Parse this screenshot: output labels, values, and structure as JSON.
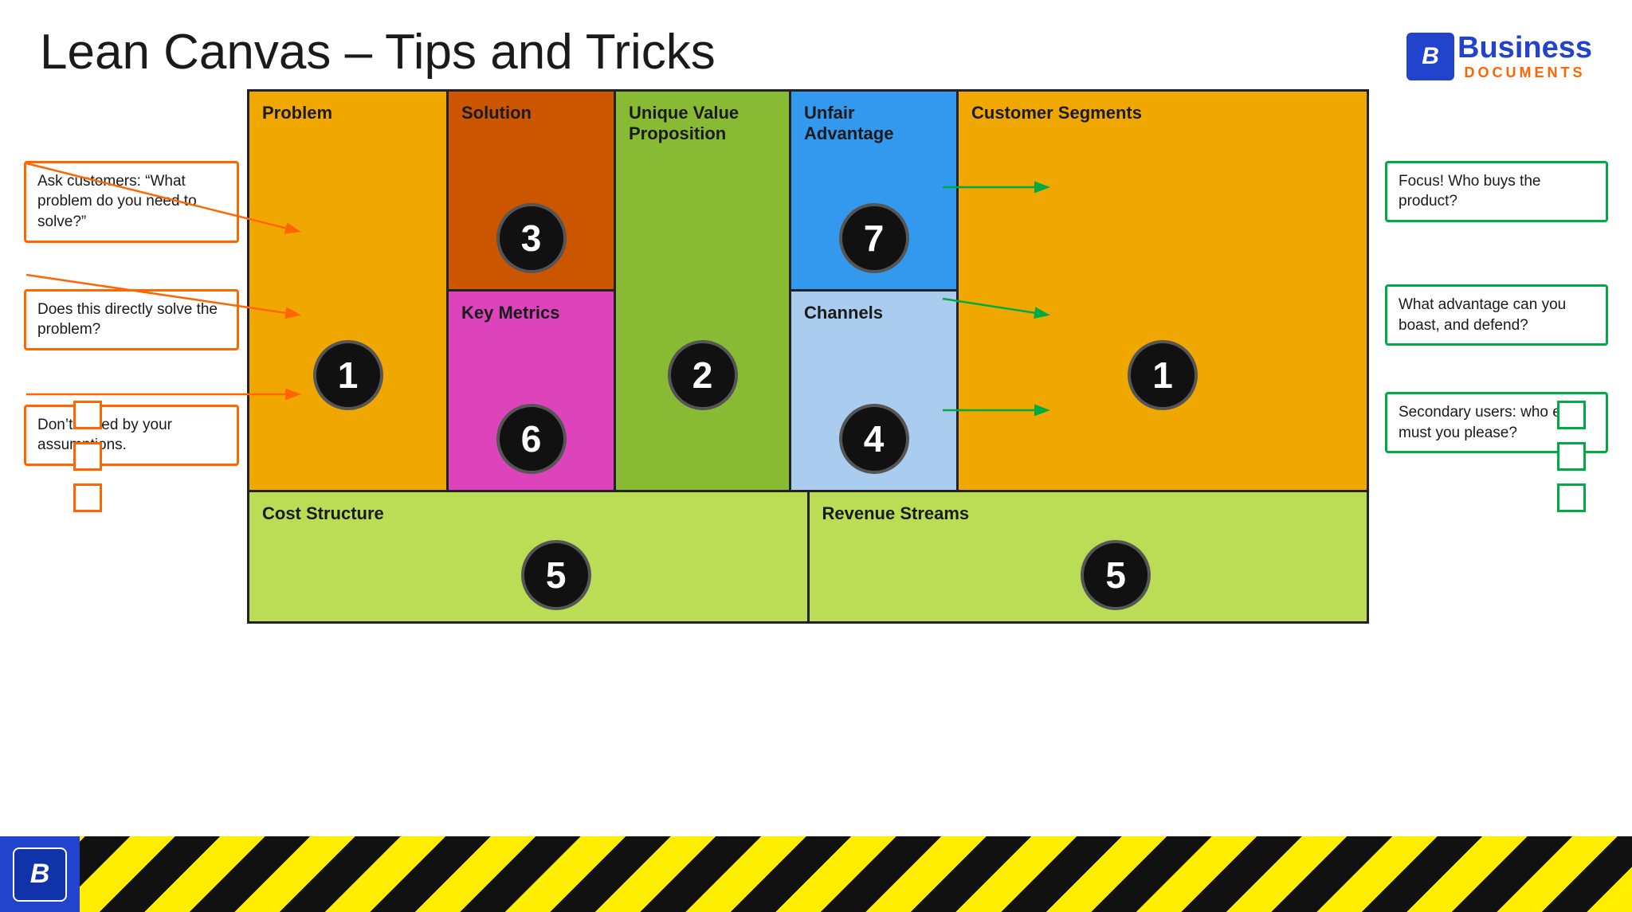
{
  "header": {
    "title": "Lean Canvas – Tips and Tricks",
    "logo": {
      "icon_letter": "B",
      "business": "Business",
      "documents": "DOCUMENTS"
    }
  },
  "canvas": {
    "cells": {
      "problem": {
        "title": "Problem",
        "number": "1",
        "color": "#f0a800"
      },
      "solution": {
        "title": "Solution",
        "number": "3",
        "color": "#cc5500"
      },
      "key_metrics": {
        "title": "Key Metrics",
        "number": "6",
        "color": "#dd44bb"
      },
      "uvp": {
        "title": "Unique Value Proposition",
        "number": "2",
        "color": "#88bb33"
      },
      "unfair_advantage": {
        "title": "Unfair Advantage",
        "number": "7",
        "color": "#3399ee"
      },
      "channels": {
        "title": "Channels",
        "number": "4",
        "color": "#aaccee"
      },
      "customer_segments": {
        "title": "Customer Segments",
        "number": "1",
        "color": "#f0a800"
      },
      "cost_structure": {
        "title": "Cost Structure",
        "number": "5",
        "color": "#bbdd55"
      },
      "revenue_streams": {
        "title": "Revenue Streams",
        "number": "5",
        "color": "#bbdd55"
      }
    }
  },
  "left_annotations": [
    {
      "text": "Ask customers: “What problem do you need to solve?”"
    },
    {
      "text": "Does this directly solve the problem?"
    },
    {
      "text": "Don’t be led by your assumptions."
    }
  ],
  "right_annotations": [
    {
      "text": "Focus! Who buys the product?"
    },
    {
      "text": "What advantage can you boast, and defend?"
    },
    {
      "text": "Secondary users: who else must you please?"
    }
  ],
  "colors": {
    "orange_border": "#ff6600",
    "green_border": "#00aa44",
    "blue_logo": "#2244cc",
    "orange_logo": "#ff6600"
  }
}
